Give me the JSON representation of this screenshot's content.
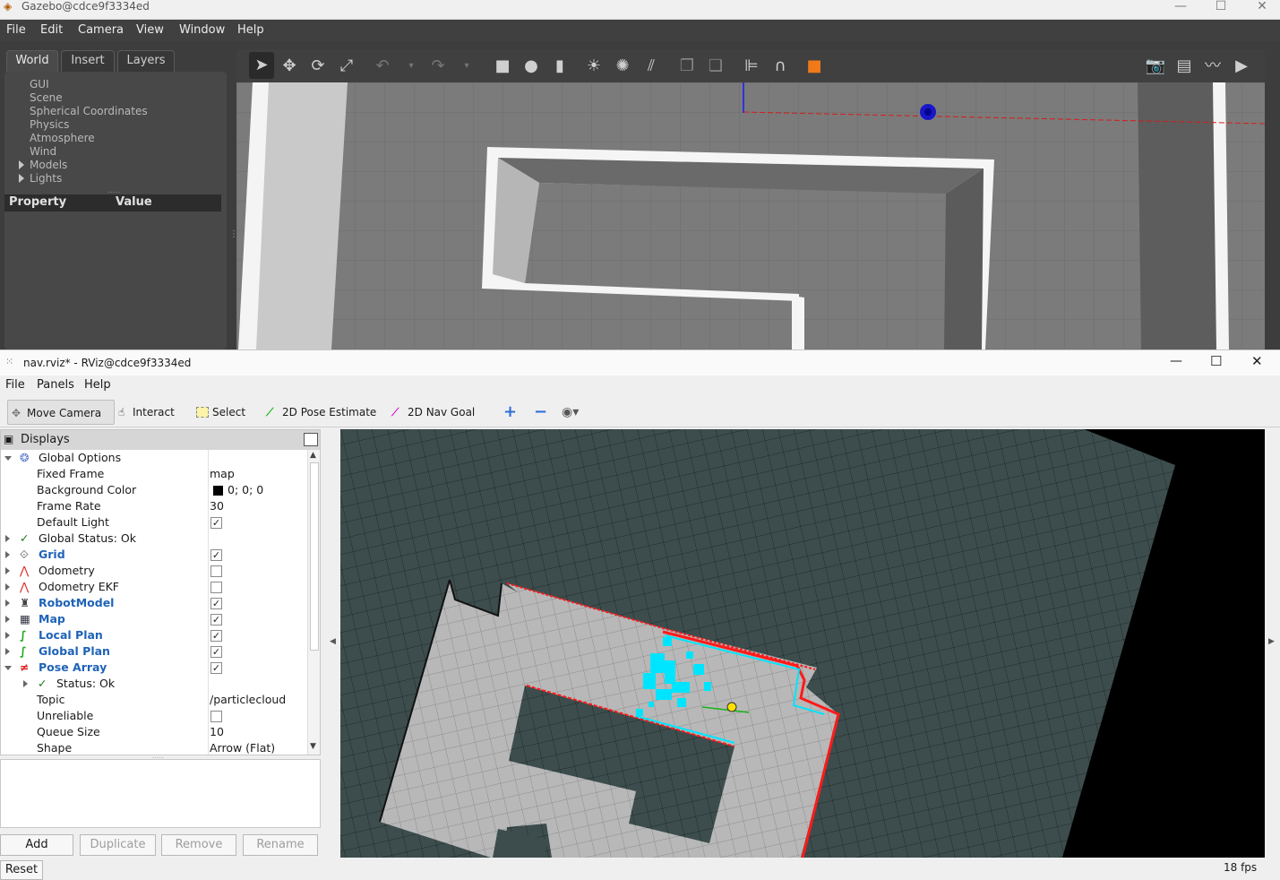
{
  "gazebo": {
    "title": "Gazebo@cdce9f3334ed",
    "menu": [
      "File",
      "Edit",
      "Camera",
      "View",
      "Window",
      "Help"
    ],
    "tabs": [
      "World",
      "Insert",
      "Layers"
    ],
    "tree": [
      "GUI",
      "Scene",
      "Spherical Coordinates",
      "Physics",
      "Atmosphere",
      "Wind",
      "Models",
      "Lights"
    ],
    "property_header": "Property",
    "value_header": "Value"
  },
  "rviz": {
    "title": "nav.rviz* - RViz@cdce9f3334ed",
    "menu": [
      "File",
      "Panels",
      "Help"
    ],
    "tools": [
      "Move Camera",
      "Interact",
      "Select",
      "2D Pose Estimate",
      "2D Nav Goal"
    ],
    "displays_title": "Displays",
    "rows": [
      {
        "name": "Global Options",
        "value": ""
      },
      {
        "name": "Fixed Frame",
        "value": "map"
      },
      {
        "name": "Background Color",
        "value": "0; 0; 0"
      },
      {
        "name": "Frame Rate",
        "value": "30"
      },
      {
        "name": "Default Light",
        "value": ""
      },
      {
        "name": "Global Status: Ok",
        "value": ""
      },
      {
        "name": "Grid",
        "value": ""
      },
      {
        "name": "Odometry",
        "value": ""
      },
      {
        "name": "Odometry EKF",
        "value": ""
      },
      {
        "name": "RobotModel",
        "value": ""
      },
      {
        "name": "Map",
        "value": ""
      },
      {
        "name": "Local Plan",
        "value": ""
      },
      {
        "name": "Global Plan",
        "value": ""
      },
      {
        "name": "Pose Array",
        "value": ""
      },
      {
        "name": "Status: Ok",
        "value": ""
      },
      {
        "name": "Topic",
        "value": "/particlecloud"
      },
      {
        "name": "Unreliable",
        "value": ""
      },
      {
        "name": "Queue Size",
        "value": "10"
      },
      {
        "name": "Shape",
        "value": "Arrow (Flat)"
      }
    ],
    "checkboxes": {
      "default_light": true,
      "grid": true,
      "odometry": false,
      "odometry_ekf": false,
      "robot_model": true,
      "map": true,
      "local_plan": true,
      "global_plan": true,
      "pose_array": true,
      "unreliable": false
    },
    "buttons": [
      "Add",
      "Duplicate",
      "Remove",
      "Rename"
    ],
    "reset": "Reset",
    "fps": "18 fps"
  },
  "colors": {
    "accent_blue": "#1e63b8",
    "map_free": "#b8b8b8",
    "map_unknown": "#3d4d4d",
    "laser": "#00e5ff",
    "obstacle": "#ff0000"
  }
}
